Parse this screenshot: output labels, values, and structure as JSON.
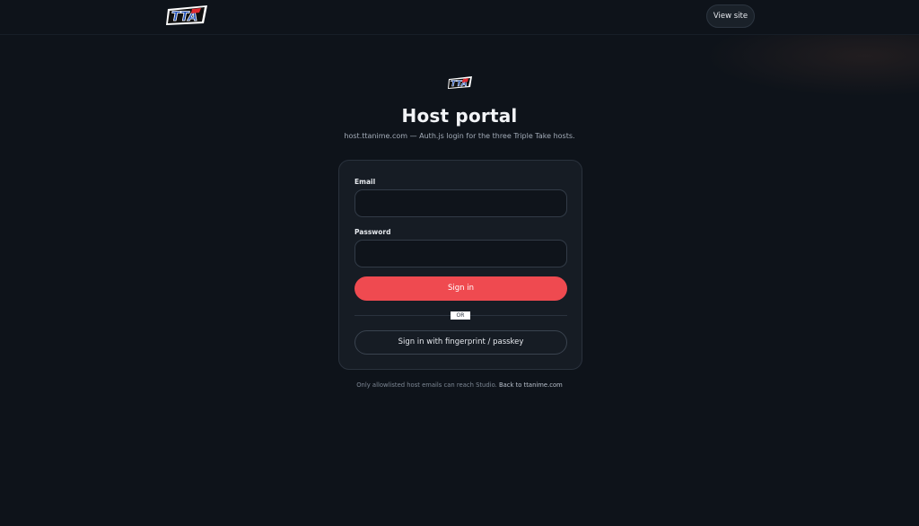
{
  "header": {
    "logo_text": "TTA",
    "view_site_label": "View site"
  },
  "main": {
    "logo_text": "TTA",
    "title": "Host portal",
    "subtitle": "host.ttanime.com — Auth.js login for the three Triple Take hosts."
  },
  "form": {
    "email_label": "Email",
    "email_value": "",
    "password_label": "Password",
    "password_value": "",
    "signin_label": "Sign in",
    "or_label": "OR",
    "passkey_label": "Sign in with fingerprint / passkey"
  },
  "footer": {
    "note": "Only allowlisted host emails can reach Studio.",
    "link_label": "Back to ttanime.com"
  },
  "colors": {
    "background": "#0e131a",
    "card": "#161c24",
    "accent": "#ef4a50",
    "logo_blue": "#1f4fb8",
    "logo_red": "#e0282e"
  }
}
